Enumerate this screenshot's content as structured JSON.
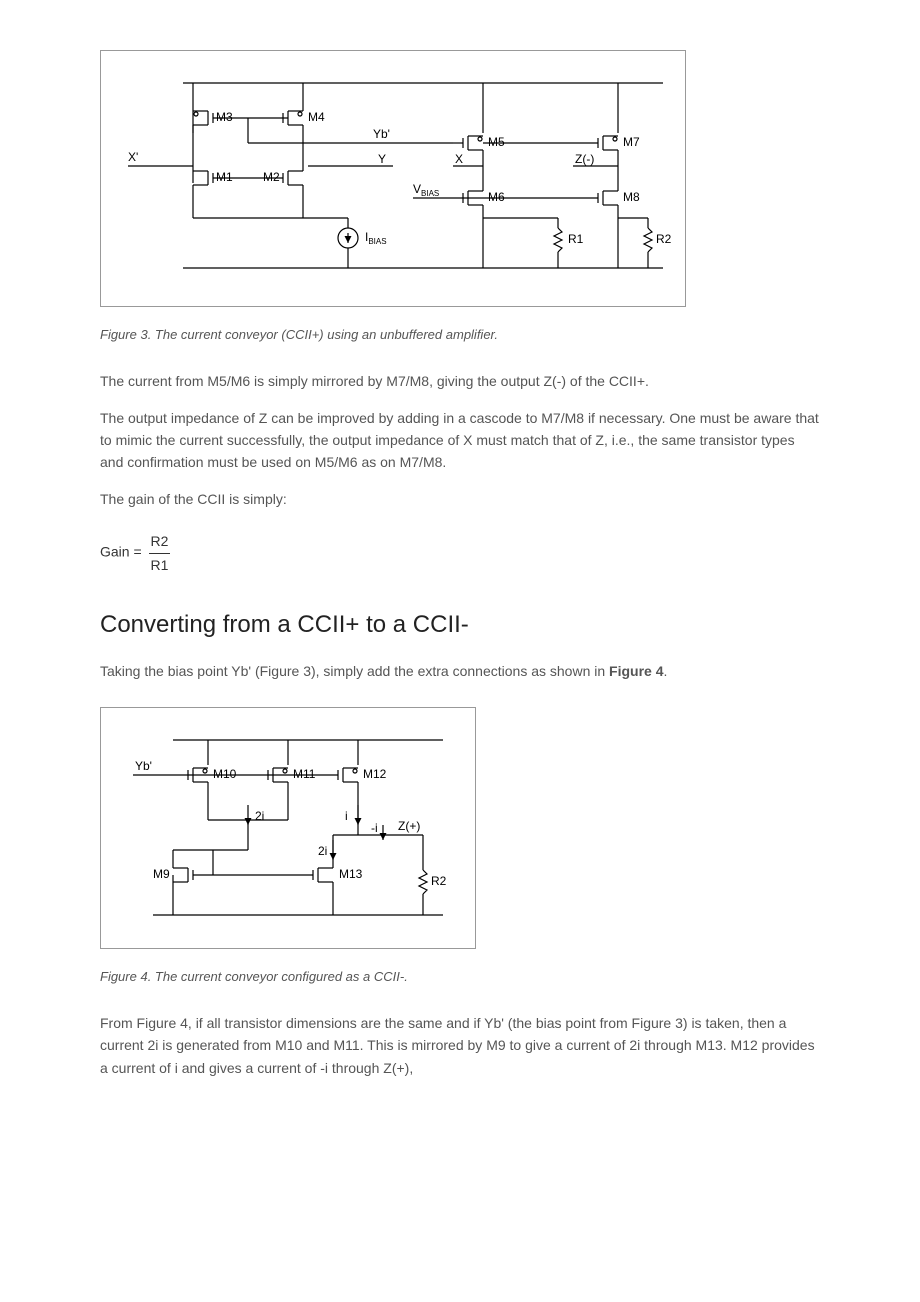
{
  "figure3": {
    "caption": "Figure 3. The current conveyor (CCII+) using an unbuffered amplifier.",
    "labels": {
      "m1": "M1",
      "m2": "M2",
      "m3": "M3",
      "m4": "M4",
      "m5": "M5",
      "m6": "M6",
      "m7": "M7",
      "m8": "M8",
      "ybp": "Yb'",
      "y": "Y",
      "x": "X",
      "xprime": "X'",
      "zneg": "Z(-)",
      "vbias": "V",
      "vbias_sub": "BIAS",
      "ibias": "I",
      "ibias_sub": "BIAS",
      "r1": "R1",
      "r2": "R2"
    }
  },
  "para1": "The current from M5/M6 is simply mirrored by M7/M8, giving the output Z(-) of the CCII+.",
  "para2": "The output impedance of Z can be improved by adding in a cascode to M7/M8 if necessary. One must be aware that to mimic the current successfully, the output impedance of X must match that of Z, i.e., the same transistor types and confirmation must be used on M5/M6 as on M7/M8.",
  "para3": "The gain of the CCII is simply:",
  "equation": {
    "lhs": "Gain =",
    "num": "R2",
    "den": "R1"
  },
  "heading": "Converting from a CCII+ to a CCII-",
  "para4_a": "Taking the bias point Yb' (Figure 3), simply add the extra connections as shown in ",
  "para4_b": "Figure 4",
  "para4_c": ".",
  "figure4": {
    "caption": "Figure 4. The current conveyor configured as a CCII-.",
    "labels": {
      "ybp": "Yb'",
      "m9": "M9",
      "m10": "M10",
      "m11": "M11",
      "m12": "M12",
      "m13": "M13",
      "twoi_a": "2i",
      "twoi_b": "2i",
      "i": "i",
      "negi": "-i",
      "zpos": "Z(+)",
      "r2": "R2"
    }
  },
  "para5": "From Figure 4, if all transistor dimensions are the same and if Yb' (the bias point from Figure 3) is taken, then a current 2i is generated from M10 and M11. This is mirrored by M9 to give a current of 2i through M13. M12 provides a current of i and gives a current of -i through Z(+),"
}
